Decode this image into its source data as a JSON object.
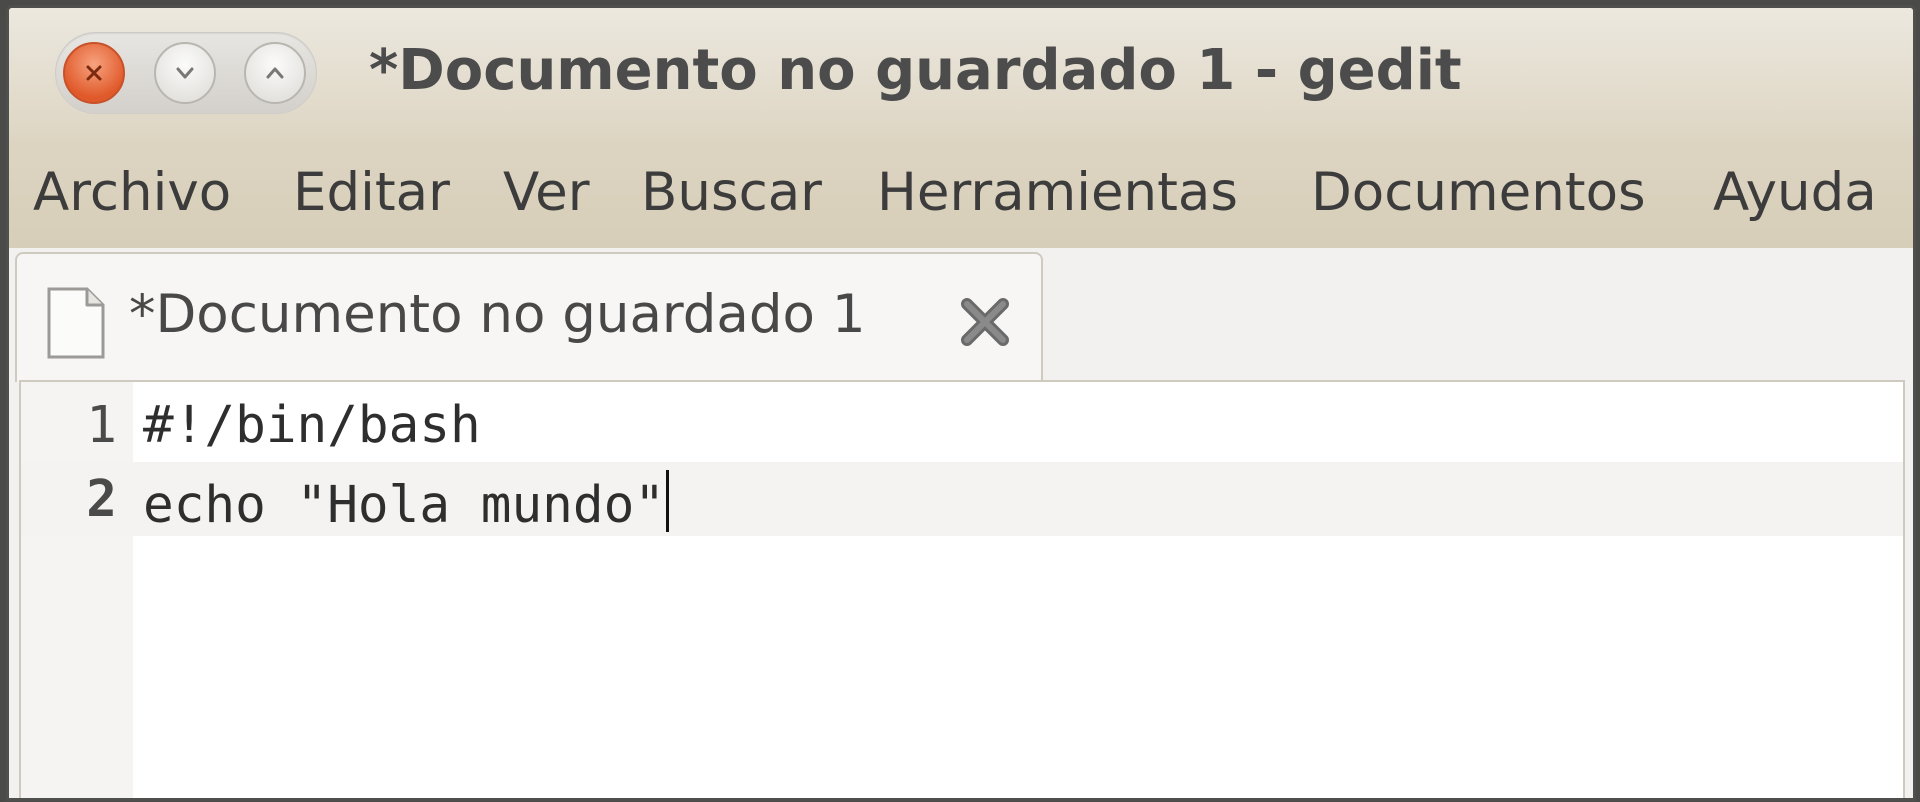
{
  "window": {
    "title": "*Documento no guardado 1 - gedit"
  },
  "window_buttons": [
    "close-icon",
    "minimize-icon",
    "maximize-icon"
  ],
  "menubar": {
    "items": [
      "Archivo",
      "Editar",
      "Ver",
      "Buscar",
      "Herramientas",
      "Documentos",
      "Ayuda"
    ]
  },
  "tab": {
    "label": "*Documento no guardado 1",
    "icon": "document-icon",
    "close_icon": "close-tab-icon"
  },
  "editor": {
    "lines": [
      {
        "number": "1",
        "text": "#!/bin/bash"
      },
      {
        "number": "2",
        "text": "echo \"Hola mundo\""
      }
    ],
    "current_line": 2
  },
  "colors": {
    "titlebar": "#e4ddcd",
    "menubar": "#dad1bd",
    "close_button": "#e0592a"
  }
}
